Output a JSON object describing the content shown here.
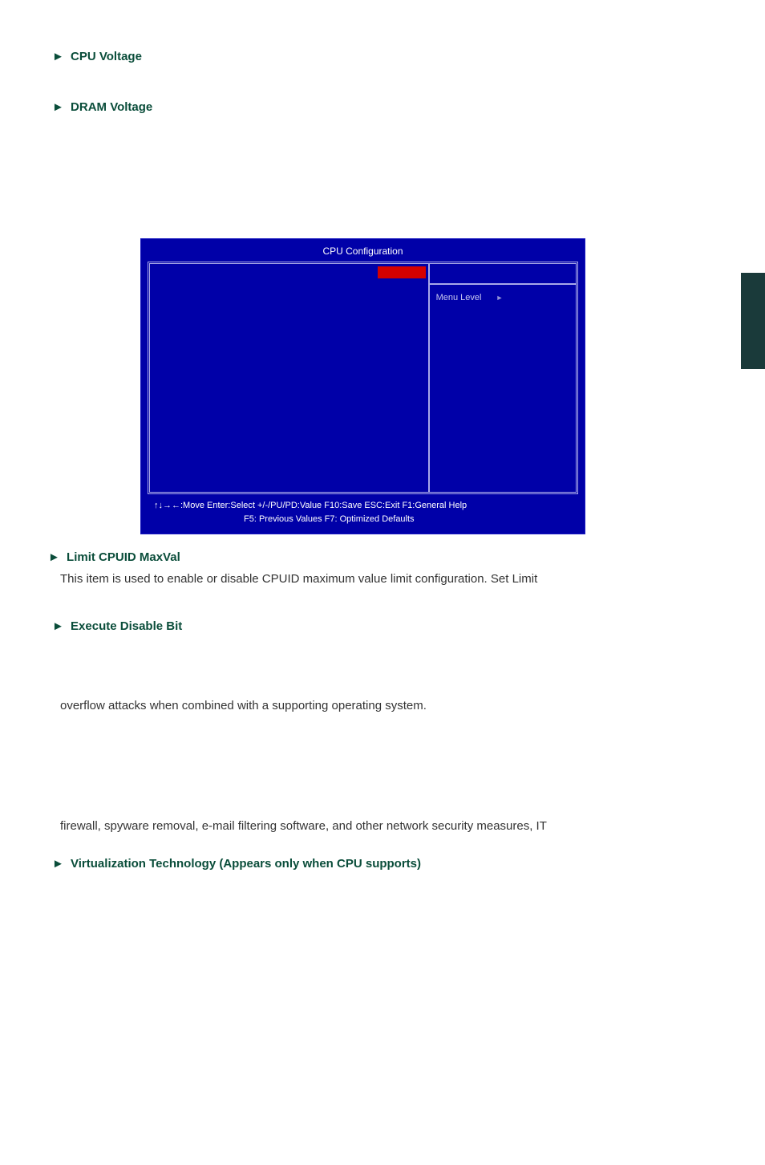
{
  "headings": {
    "cpu_voltage": "CPU Voltage",
    "dram_voltage": "DRAM Voltage",
    "limit_cpuid": "Limit CPUID MaxVal",
    "execute_disable": "Execute Disable Bit",
    "virtualization": "Virtualization Technology  (Appears only when CPU supports)"
  },
  "body": {
    "limit_cpuid_text": "This item is used to enable or disable CPUID maximum value limit configuration. Set Limit",
    "execute_text1": "overflow attacks when combined with a supporting operating system.",
    "execute_text2": "firewall, spyware removal, e-mail filtering software, and other network security measures, IT"
  },
  "arrow": "►",
  "bios": {
    "title": "CPU Configuration",
    "menu_level": "Menu Level",
    "menu_level_arrow": "►",
    "footer_line1": "↑↓→←:Move   Enter:Select    +/-/PU/PD:Value   F10:Save      ESC:Exit   F1:General Help",
    "footer_line2": "F5: Previous Values             F7: Optimized Defaults"
  }
}
